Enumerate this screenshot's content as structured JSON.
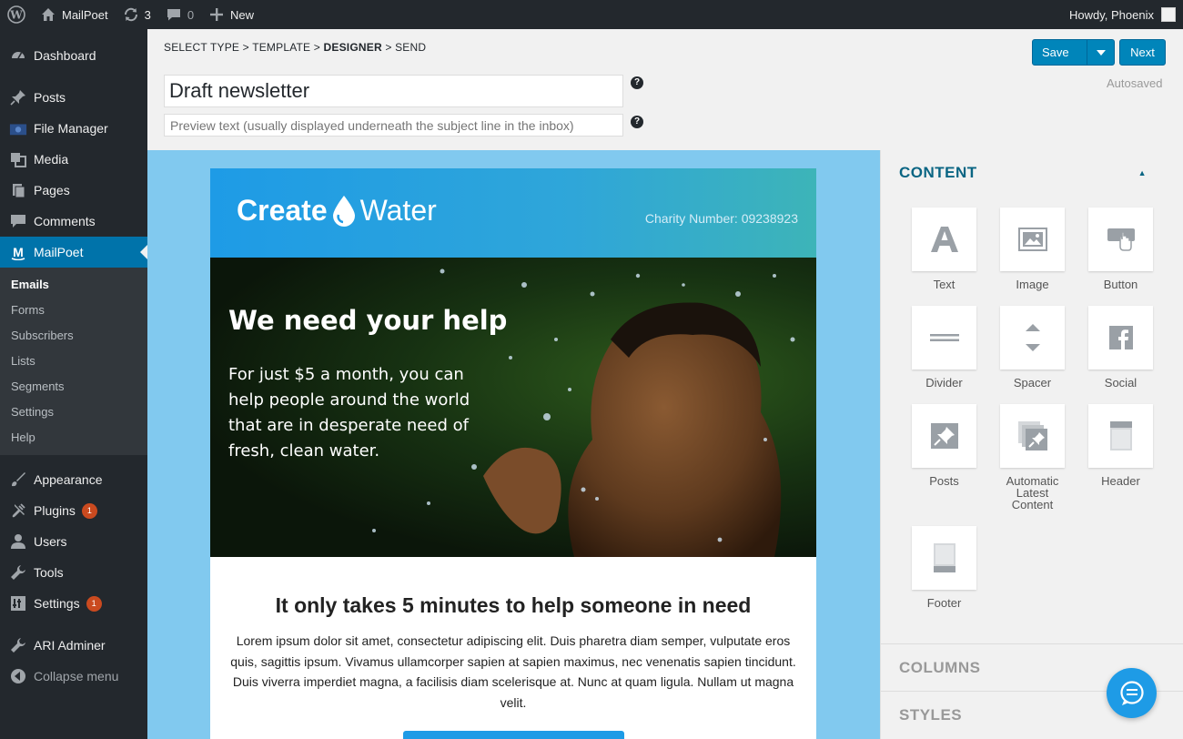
{
  "adminbar": {
    "site_name": "MailPoet",
    "updates_count": "3",
    "comments_count": "0",
    "new_label": "New",
    "howdy": "Howdy, Phoenix"
  },
  "sidebar": {
    "items_top": [
      {
        "label": "Dashboard",
        "icon": "dashboard-icon"
      },
      {
        "label": "Posts",
        "icon": "pin-icon"
      },
      {
        "label": "File Manager",
        "icon": "folder-icon"
      },
      {
        "label": "Media",
        "icon": "media-icon"
      },
      {
        "label": "Pages",
        "icon": "pages-icon"
      },
      {
        "label": "Comments",
        "icon": "comment-icon"
      },
      {
        "label": "MailPoet",
        "icon": "mailpoet-icon"
      }
    ],
    "submenu": [
      "Emails",
      "Forms",
      "Subscribers",
      "Lists",
      "Segments",
      "Settings",
      "Help"
    ],
    "items_bottom": [
      {
        "label": "Appearance",
        "icon": "brush-icon"
      },
      {
        "label": "Plugins",
        "icon": "plug-icon",
        "badge": "1"
      },
      {
        "label": "Users",
        "icon": "user-icon"
      },
      {
        "label": "Tools",
        "icon": "wrench-icon"
      },
      {
        "label": "Settings",
        "icon": "settings-icon",
        "badge": "1"
      },
      {
        "label": "ARI Adminer",
        "icon": "wrench-icon"
      },
      {
        "label": "Collapse menu",
        "icon": "collapse-icon"
      }
    ]
  },
  "breadcrumb": {
    "step1": "SELECT TYPE",
    "step2": "TEMPLATE",
    "step3": "DESIGNER",
    "step4": "SEND",
    "sep": " > "
  },
  "editor": {
    "subject": "Draft newsletter",
    "preview_placeholder": "Preview text (usually displayed underneath the subject line in the inbox)",
    "save_label": "Save",
    "next_label": "Next",
    "autosaved": "Autosaved",
    "help_glyph": "?"
  },
  "email": {
    "logo_create": "Create",
    "logo_water": "Water",
    "charity": "Charity Number: 09238923",
    "hero_title": "We need your help",
    "hero_body": "For just $5 a month, you can help people around the world that are in desperate need of fresh, clean water.",
    "body_title": "It only takes 5 minutes to help someone in need",
    "body_text": "Lorem ipsum dolor sit amet, consectetur adipiscing elit. Duis pharetra diam semper, vulputate eros quis, sagittis ipsum. Vivamus ullamcorper sapien at sapien maximus, nec venenatis sapien tincidunt. Duis viverra imperdiet magna, a facilisis diam scelerisque at. Nunc at quam ligula. Nullam ut magna velit."
  },
  "panel": {
    "content_title": "CONTENT",
    "columns_title": "COLUMNS",
    "styles_title": "STYLES",
    "widgets": [
      {
        "label": "Text",
        "icon": "text-icon"
      },
      {
        "label": "Image",
        "icon": "image-icon"
      },
      {
        "label": "Button",
        "icon": "button-icon"
      },
      {
        "label": "Divider",
        "icon": "divider-icon"
      },
      {
        "label": "Spacer",
        "icon": "spacer-icon"
      },
      {
        "label": "Social",
        "icon": "facebook-icon"
      },
      {
        "label": "Posts",
        "icon": "posts-icon"
      },
      {
        "label": "Automatic Latest Content",
        "icon": "alc-icon"
      },
      {
        "label": "Header",
        "icon": "header-icon"
      },
      {
        "label": "Footer",
        "icon": "footer-icon"
      }
    ]
  },
  "colors": {
    "admin_dark": "#23282d",
    "accent_blue": "#0073aa",
    "button_blue": "#0085ba",
    "canvas_bg": "#81c9ef",
    "email_header": "#1e9be6",
    "panel_heading": "#0a6583"
  }
}
